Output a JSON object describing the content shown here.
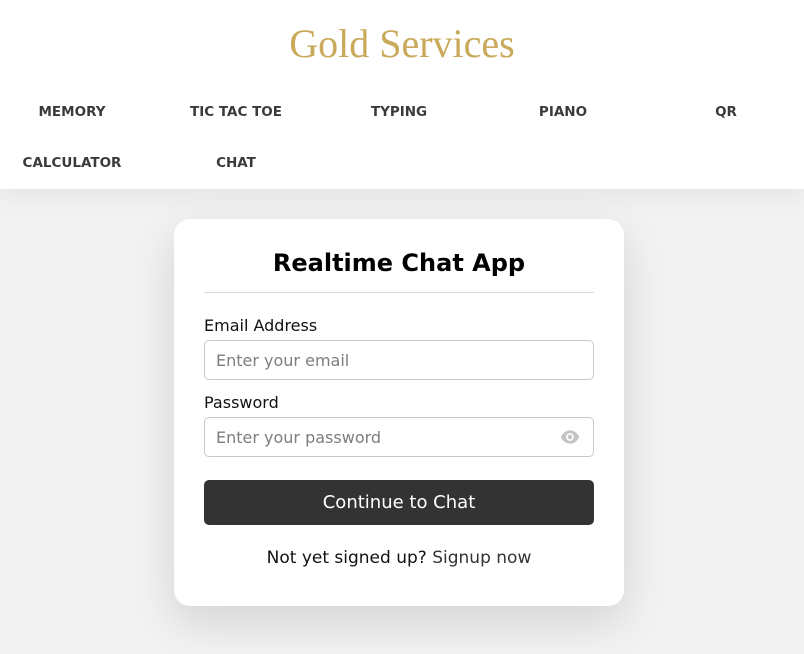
{
  "header": {
    "brand": "Gold Services",
    "brand_color": "#c9a95a"
  },
  "nav": {
    "items": [
      {
        "label": "MEMORY"
      },
      {
        "label": "TIC TAC TOE"
      },
      {
        "label": "TYPING"
      },
      {
        "label": "PIANO"
      },
      {
        "label": "QR"
      },
      {
        "label": "CALCULATOR"
      },
      {
        "label": "CHAT"
      }
    ]
  },
  "card": {
    "title": "Realtime Chat App",
    "email": {
      "label": "Email Address",
      "placeholder": "Enter your email",
      "value": ""
    },
    "password": {
      "label": "Password",
      "placeholder": "Enter your password",
      "value": "",
      "toggle_icon": "eye-icon"
    },
    "submit_label": "Continue to Chat",
    "submit_color": "#333333",
    "signup_prompt": "Not yet signed up?",
    "signup_link": "Signup now"
  }
}
